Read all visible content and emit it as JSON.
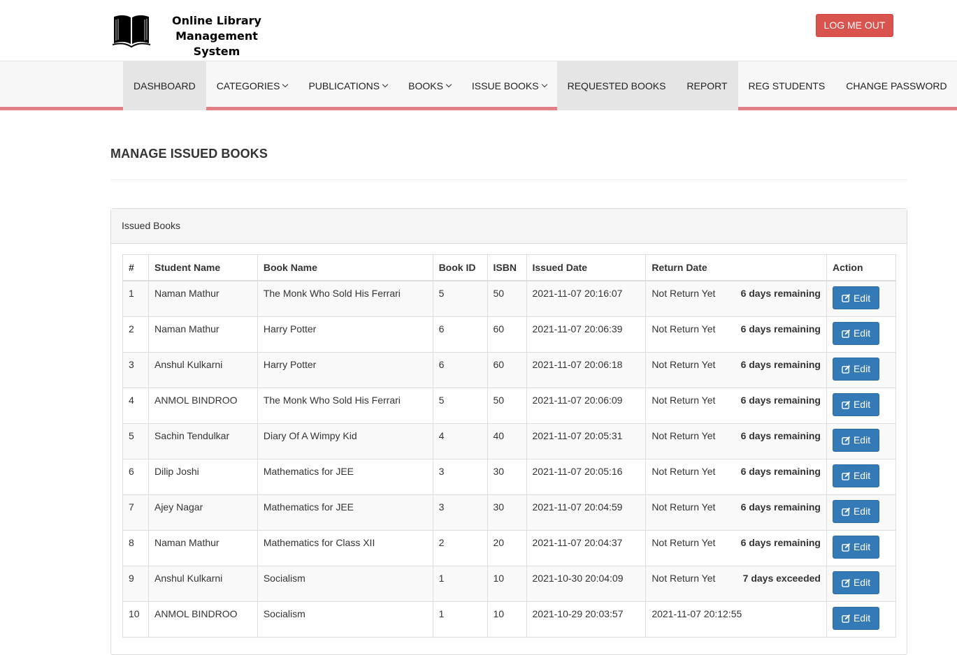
{
  "header": {
    "logo_icon": "open-book-icon",
    "app_title_line1": "Online Library",
    "app_title_line2": "Management System",
    "logout_label": "LOG ME OUT"
  },
  "nav": {
    "items": [
      {
        "label": "DASHBOARD",
        "dropdown": false,
        "active": true
      },
      {
        "label": "CATEGORIES",
        "dropdown": true,
        "active": false
      },
      {
        "label": "PUBLICATIONS",
        "dropdown": true,
        "active": false
      },
      {
        "label": "BOOKS",
        "dropdown": true,
        "active": false
      },
      {
        "label": "ISSUE BOOKS",
        "dropdown": true,
        "active": false
      },
      {
        "label": "REQUESTED BOOKS",
        "dropdown": false,
        "active": true
      },
      {
        "label": "REPORT",
        "dropdown": false,
        "active": true
      },
      {
        "label": "REG STUDENTS",
        "dropdown": false,
        "active": false
      },
      {
        "label": "CHANGE PASSWORD",
        "dropdown": false,
        "active": false
      }
    ],
    "accent_color": "#e07f84"
  },
  "page": {
    "title": "MANAGE ISSUED BOOKS",
    "panel_heading": "Issued Books"
  },
  "table": {
    "headers": [
      "#",
      "Student Name",
      "Book Name",
      "Book ID",
      "ISBN",
      "Issued Date",
      "Return Date",
      "Action"
    ],
    "edit_label": "Edit",
    "edit_icon": "edit-icon",
    "rows": [
      {
        "num": "1",
        "student": "Naman Mathur",
        "book": "The Monk Who Sold His Ferrari",
        "book_id": "5",
        "isbn": "50",
        "issued": "2021-11-07 20:16:07",
        "returned": "Not Return Yet",
        "remaining": "6 days remaining"
      },
      {
        "num": "2",
        "student": "Naman Mathur",
        "book": "Harry Potter",
        "book_id": "6",
        "isbn": "60",
        "issued": "2021-11-07 20:06:39",
        "returned": "Not Return Yet",
        "remaining": "6 days remaining"
      },
      {
        "num": "3",
        "student": "Anshul Kulkarni",
        "book": "Harry Potter",
        "book_id": "6",
        "isbn": "60",
        "issued": "2021-11-07 20:06:18",
        "returned": "Not Return Yet",
        "remaining": "6 days remaining"
      },
      {
        "num": "4",
        "student": "ANMOL BINDROO",
        "book": "The Monk Who Sold His Ferrari",
        "book_id": "5",
        "isbn": "50",
        "issued": "2021-11-07 20:06:09",
        "returned": "Not Return Yet",
        "remaining": "6 days remaining"
      },
      {
        "num": "5",
        "student": "Sachin Tendulkar",
        "book": "Diary Of A Wimpy Kid",
        "book_id": "4",
        "isbn": "40",
        "issued": "2021-11-07 20:05:31",
        "returned": "Not Return Yet",
        "remaining": "6 days remaining"
      },
      {
        "num": "6",
        "student": "Dilip Joshi",
        "book": "Mathematics for JEE",
        "book_id": "3",
        "isbn": "30",
        "issued": "2021-11-07 20:05:16",
        "returned": "Not Return Yet",
        "remaining": "6 days remaining"
      },
      {
        "num": "7",
        "student": "Ajey Nagar",
        "book": "Mathematics for JEE",
        "book_id": "3",
        "isbn": "30",
        "issued": "2021-11-07 20:04:59",
        "returned": "Not Return Yet",
        "remaining": "6 days remaining"
      },
      {
        "num": "8",
        "student": "Naman Mathur",
        "book": "Mathematics for Class XII",
        "book_id": "2",
        "isbn": "20",
        "issued": "2021-11-07 20:04:37",
        "returned": "Not Return Yet",
        "remaining": "6 days remaining"
      },
      {
        "num": "9",
        "student": "Anshul Kulkarni",
        "book": "Socialism",
        "book_id": "1",
        "isbn": "10",
        "issued": "2021-10-30 20:04:09",
        "returned": "Not Return Yet",
        "remaining": "7 days exceeded"
      },
      {
        "num": "10",
        "student": "ANMOL BINDROO",
        "book": "Socialism",
        "book_id": "1",
        "isbn": "10",
        "issued": "2021-10-29 20:03:57",
        "returned": "2021-11-07 20:12:55",
        "remaining": ""
      }
    ]
  },
  "colors": {
    "logout": "#d9534f",
    "edit_button": "#337ab7"
  }
}
